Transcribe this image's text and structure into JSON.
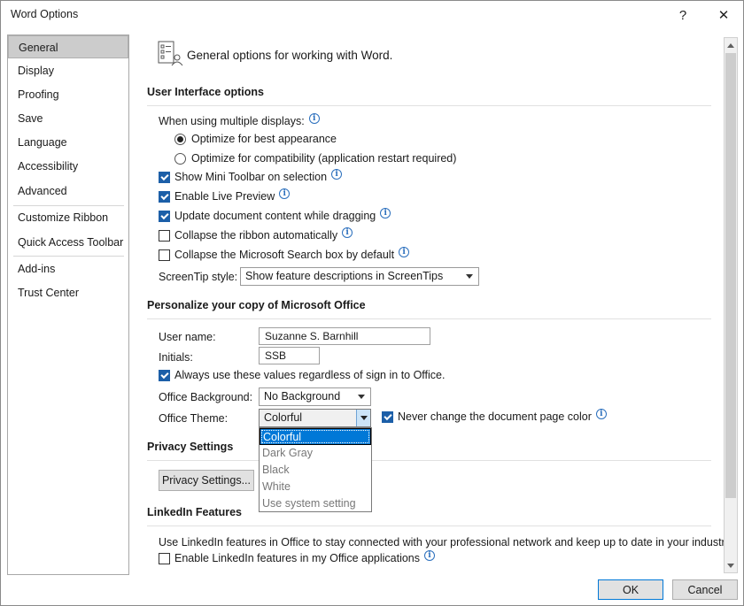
{
  "window": {
    "title": "Word Options",
    "help_glyph": "?",
    "close_glyph": "✕"
  },
  "sidebar": {
    "items": [
      {
        "label": "General",
        "active": true
      },
      {
        "label": "Display"
      },
      {
        "label": "Proofing"
      },
      {
        "label": "Save"
      },
      {
        "label": "Language"
      },
      {
        "label": "Accessibility"
      },
      {
        "label": "Advanced"
      },
      {
        "label": "Customize Ribbon"
      },
      {
        "label": "Quick Access Toolbar"
      },
      {
        "label": "Add-ins"
      },
      {
        "label": "Trust Center"
      }
    ]
  },
  "header": {
    "text": "General options for working with Word.",
    "icon": "general-options-icon"
  },
  "ui_options": {
    "title": "User Interface options",
    "multiple_displays_label": "When using multiple displays:",
    "radio_best": "Optimize for best appearance",
    "radio_compat": "Optimize for compatibility (application restart required)",
    "mini_toolbar": "Show Mini Toolbar on selection",
    "live_preview": "Enable Live Preview",
    "update_dragging": "Update document content while dragging",
    "collapse_ribbon": "Collapse the ribbon automatically",
    "collapse_search": "Collapse the Microsoft Search box by default",
    "screentip_label": "ScreenTip style:",
    "screentip_value": "Show feature descriptions in ScreenTips"
  },
  "personalize": {
    "title": "Personalize your copy of Microsoft Office",
    "user_name_label": "User name:",
    "user_name_value": "Suzanne S. Barnhill",
    "initials_label": "Initials:",
    "initials_value": "SSB",
    "always_use": "Always use these values regardless of sign in to Office.",
    "background_label": "Office Background:",
    "background_value": "No Background",
    "theme_label": "Office Theme:",
    "theme_value": "Colorful",
    "never_change": "Never change the document page color"
  },
  "theme_dropdown": {
    "options": [
      "Colorful",
      "Dark Gray",
      "Black",
      "White",
      "Use system setting"
    ],
    "selected": "Colorful"
  },
  "privacy": {
    "title": "Privacy Settings",
    "button": "Privacy Settings..."
  },
  "linkedin": {
    "title": "LinkedIn Features",
    "description": "Use LinkedIn features in Office to stay connected with your professional network and keep up to date in your industry.",
    "enable": "Enable LinkedIn features in my Office applications"
  },
  "footer": {
    "ok": "OK",
    "cancel": "Cancel"
  },
  "colors": {
    "accent": "#0078d7",
    "checkbox": "#1c5fa8",
    "info": "#2b6fbd",
    "selected_nav": "#cccccc"
  }
}
